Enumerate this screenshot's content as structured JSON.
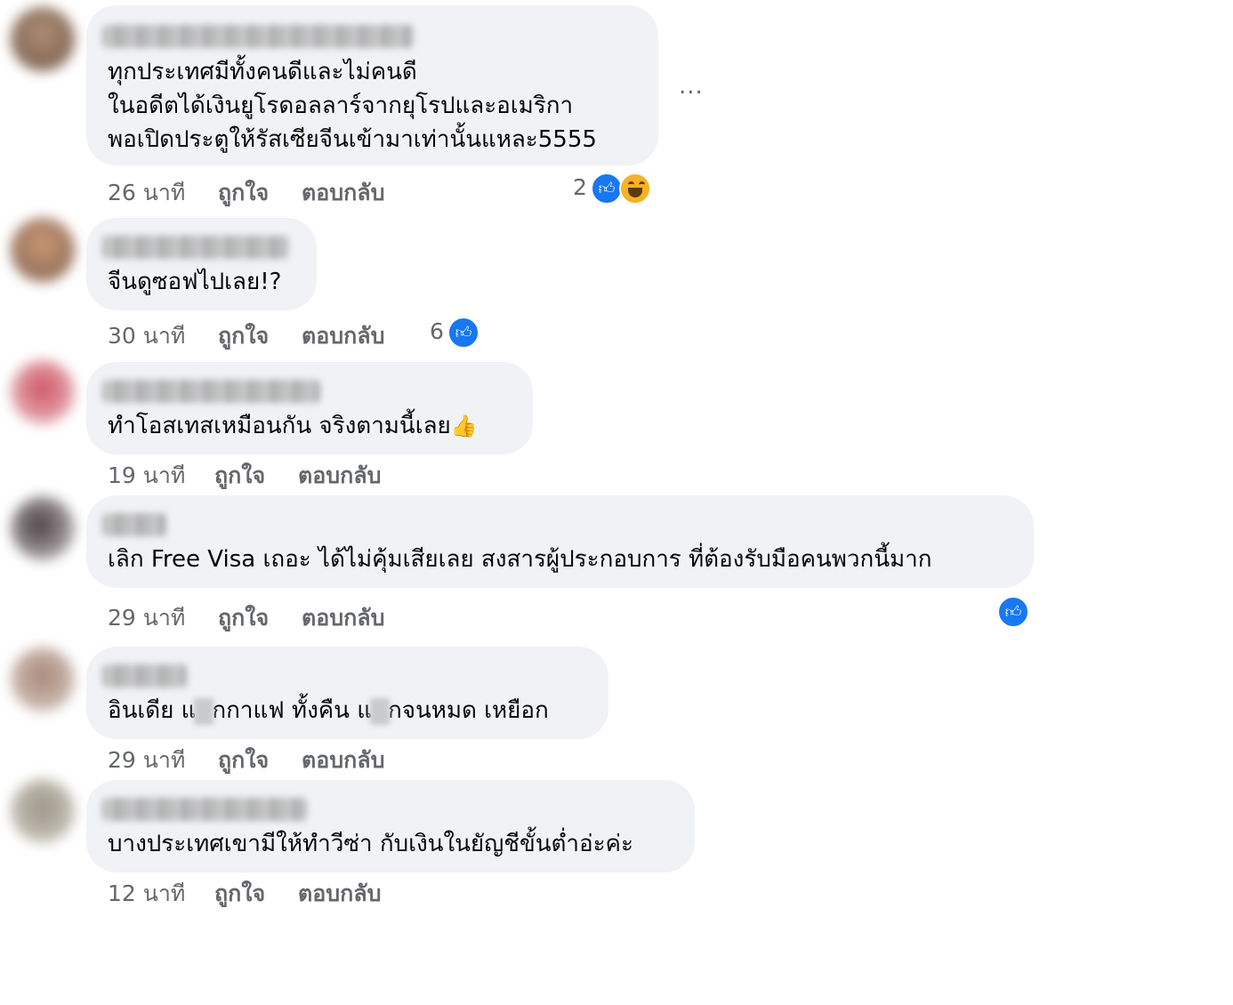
{
  "more_options_label": "...",
  "comments": [
    {
      "text_lines": [
        "ทุกประเทศมีทั้งคนดีและไม่คนดี",
        "ในอดีตได้เงินยูโรดอลลาร์จากยุโรปและอเมริกา",
        "พอเปิดประตูให้รัสเซียจีนเข้ามาเท่านั้นแหละ5555"
      ],
      "time": "26 นาที",
      "like_label": "ถูกใจ",
      "reply_label": "ตอบกลับ",
      "reaction_count": "2",
      "reactions": [
        "like-icon",
        "haha-icon"
      ],
      "avatar_color": "#7a5a44"
    },
    {
      "text_lines": [
        "จีนดูซอฟไปเลย!?"
      ],
      "time": "30 นาที",
      "like_label": "ถูกใจ",
      "reply_label": "ตอบกลับ",
      "reaction_count": "6",
      "reactions": [
        "like-icon"
      ],
      "avatar_color": "#9a6a4a"
    },
    {
      "text_lines": [
        "ทำโอสเทสเหมือนกัน จริงตามนี้เลย"
      ],
      "emoji": "👍",
      "time": "19 นาที",
      "like_label": "ถูกใจ",
      "reply_label": "ตอบกลับ",
      "reaction_count": "",
      "reactions": [],
      "avatar_color": "#b03a48"
    },
    {
      "text_lines": [
        "เลิก Free Visa เถอะ ได้ไม่คุ้มเสียเลย สงสารผู้ประกอบการ ที่ต้องรับมือคนพวกนี้มาก"
      ],
      "time": "29 นาที",
      "like_label": "ถูกใจ",
      "reply_label": "ตอบกลับ",
      "reaction_count": "",
      "reactions": [
        "like-icon"
      ],
      "avatar_color": "#3a3236"
    },
    {
      "text_parts": [
        "อินเดีย แ",
        "กกาแฟ ทั้งคืน แ",
        "กจนหมด เหยือก"
      ],
      "time": "29 นาที",
      "like_label": "ถูกใจ",
      "reply_label": "ตอบกลับ",
      "reaction_count": "",
      "reactions": [],
      "avatar_color": "#8a6a5a"
    },
    {
      "text_lines": [
        "บางประเทศเขามีให้ทำวีซ่า กับเงินในยัญชีขั้นต่ำอ่ะค่ะ"
      ],
      "time": "12 นาที",
      "like_label": "ถูกใจ",
      "reply_label": "ตอบกลับ",
      "reaction_count": "",
      "reactions": [],
      "avatar_color": "#7a7464"
    }
  ]
}
